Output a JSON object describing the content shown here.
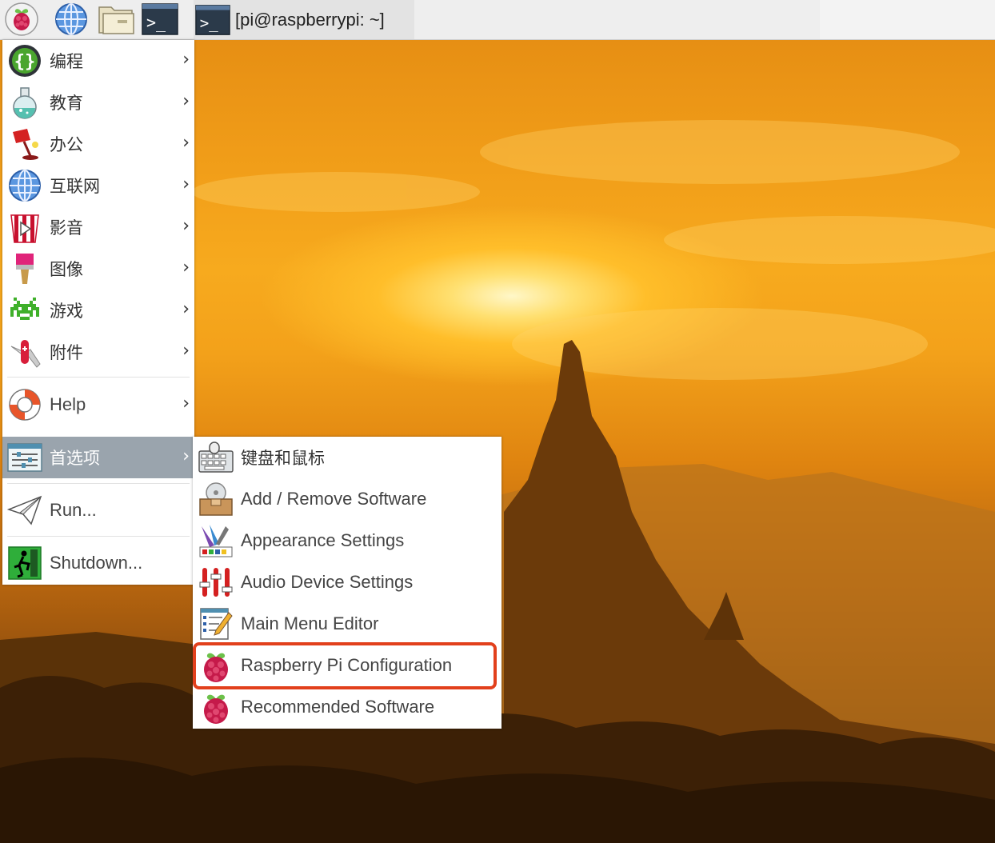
{
  "taskbar": {
    "launchers": [
      {
        "name": "raspberry-menu-icon"
      },
      {
        "name": "web-browser-icon"
      },
      {
        "name": "file-manager-icon"
      },
      {
        "name": "terminal-icon"
      }
    ],
    "window_title": "[pi@raspberrypi: ~]"
  },
  "main_menu": {
    "items": [
      {
        "label": "编程",
        "icon": "code-braces-icon"
      },
      {
        "label": "教育",
        "icon": "flask-icon"
      },
      {
        "label": "办公",
        "icon": "desk-lamp-icon"
      },
      {
        "label": "互联网",
        "icon": "globe-icon"
      },
      {
        "label": "影音",
        "icon": "popcorn-icon"
      },
      {
        "label": "图像",
        "icon": "paintbrush-icon"
      },
      {
        "label": "游戏",
        "icon": "space-invader-icon"
      },
      {
        "label": "附件",
        "icon": "pocket-knife-icon"
      },
      {
        "label": "Help",
        "icon": "lifebuoy-icon"
      },
      {
        "label": "首选项",
        "icon": "preferences-sliders-icon"
      },
      {
        "label": "Run...",
        "icon": "paper-plane-icon"
      },
      {
        "label": "Shutdown...",
        "icon": "running-man-icon"
      }
    ],
    "arrow": "›",
    "selected_index": 9
  },
  "submenu": {
    "items": [
      {
        "label": "键盘和鼠标",
        "icon": "keyboard-mouse-icon"
      },
      {
        "label": "Add / Remove Software",
        "icon": "software-package-icon"
      },
      {
        "label": "Appearance Settings",
        "icon": "appearance-palette-icon"
      },
      {
        "label": "Audio Device Settings",
        "icon": "audio-mixer-icon"
      },
      {
        "label": "Main Menu Editor",
        "icon": "menu-editor-icon"
      },
      {
        "label": "Raspberry Pi Configuration",
        "icon": "raspberry-icon"
      },
      {
        "label": "Recommended Software",
        "icon": "raspberry-icon"
      }
    ],
    "highlighted_index": 5
  },
  "colors": {
    "selected_item": "#9aa4ad",
    "highlight_border": "#e2401c",
    "raspberry_red": "#c51a4a",
    "leaf_green": "#6cc04a"
  }
}
